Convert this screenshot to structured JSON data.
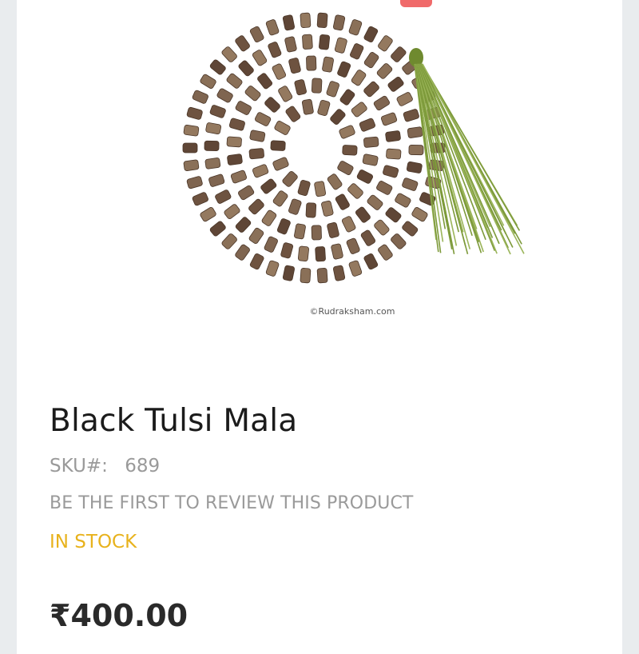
{
  "product": {
    "image_watermark": "©Rudraksham.com",
    "title": "Black Tulsi Mala",
    "sku_label": "SKU#:",
    "sku_value": "689",
    "review_link": "BE THE FIRST TO REVIEW THIS PRODUCT",
    "stock_status": "IN STOCK",
    "price": "₹400.00"
  },
  "colors": {
    "stock": "#e8b21c",
    "title": "#1b1b1b",
    "muted": "#9a9a9a",
    "tassel": "#7d9a3a",
    "bead": "#7a5c44"
  }
}
